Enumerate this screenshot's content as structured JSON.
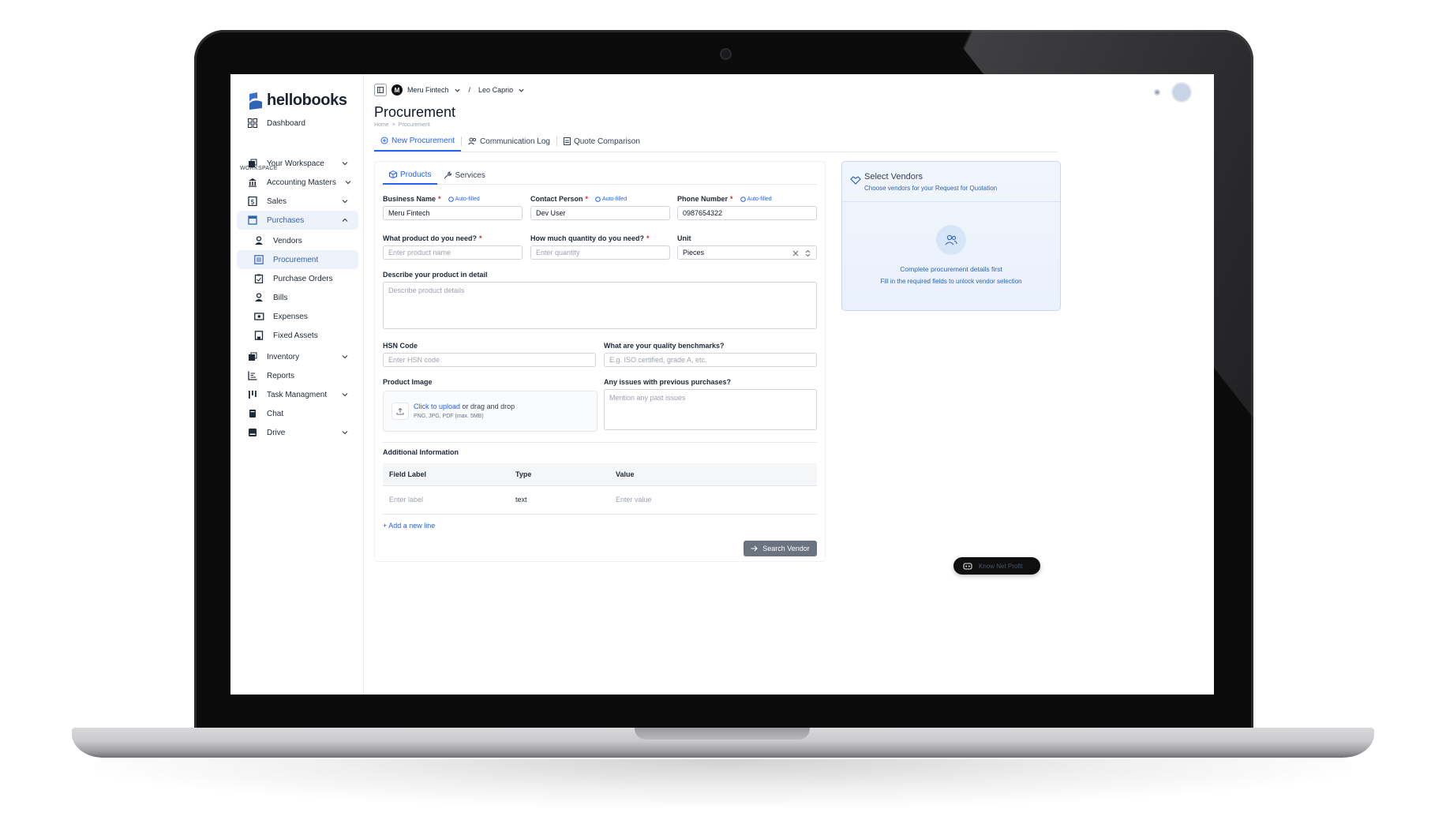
{
  "app": {
    "logo_text": "hellobooks",
    "brand_color": "#2e63b8",
    "accent_color": "#2563eb"
  },
  "topbar": {
    "org_badge": "M",
    "org_name": "Meru Fintech",
    "separator": "/",
    "user_name": "Leo Caprio"
  },
  "sidebar": {
    "dashboard": "Dashboard",
    "workspace_heading": "WORKSPACE",
    "items": [
      {
        "label": "Your Workspace",
        "icon": "workspace-icon"
      },
      {
        "label": "Accounting Masters",
        "icon": "bank-icon"
      },
      {
        "label": "Sales",
        "icon": "dollar-icon"
      },
      {
        "label": "Purchases",
        "icon": "cart-icon"
      },
      {
        "label": "Vendors",
        "icon": "person-icon"
      },
      {
        "label": "Procurement",
        "icon": "list-icon"
      },
      {
        "label": "Purchase Orders",
        "icon": "clipboard-icon"
      },
      {
        "label": "Bills",
        "icon": "person-icon"
      },
      {
        "label": "Expenses",
        "icon": "cash-icon"
      },
      {
        "label": "Fixed Assets",
        "icon": "asset-icon"
      },
      {
        "label": "Inventory",
        "icon": "box-icon"
      },
      {
        "label": "Reports",
        "icon": "chart-icon"
      },
      {
        "label": "Task Managment",
        "icon": "task-icon"
      },
      {
        "label": "Chat",
        "icon": "chat-icon"
      },
      {
        "label": "Drive",
        "icon": "drive-icon"
      }
    ]
  },
  "page": {
    "title": "Procurement",
    "breadcrumb": [
      "Home",
      ">",
      "Procurement"
    ],
    "tabs": [
      "New Procurement",
      "Communication Log",
      "Quote Comparison"
    ]
  },
  "form": {
    "subtabs": [
      "Products",
      "Services"
    ],
    "autofilled": "Auto-filled",
    "business_name": {
      "label": "Business Name",
      "value": "Meru Fintech"
    },
    "contact_person": {
      "label": "Contact Person",
      "value": "Dev User"
    },
    "phone_number": {
      "label": "Phone Number",
      "value": "0987654322"
    },
    "product": {
      "label": "What product do you need?",
      "placeholder": "Enter product name"
    },
    "quantity": {
      "label": "How much quantity do you need?",
      "placeholder": "Enter quantity"
    },
    "unit": {
      "label": "Unit",
      "value": "Pieces"
    },
    "describe": {
      "label": "Describe your product in detail",
      "placeholder": "Describe product details"
    },
    "hsn": {
      "label": "HSN Code",
      "placeholder": "Enter HSN code"
    },
    "benchmarks": {
      "label": "What are your quality benchmarks?",
      "placeholder": "E.g. ISO certified, grade A, etc."
    },
    "image": {
      "label": "Product Image",
      "link": "Click to upload",
      "rest": " or drag and drop",
      "hint": "PNG, JPG, PDF (max. 5MB)"
    },
    "issues": {
      "label": "Any issues with previous purchases?",
      "placeholder": "Mention any past issues"
    },
    "additional": {
      "title": "Additional Information",
      "headers": [
        "Field Label",
        "Type",
        "Value"
      ],
      "row": {
        "label_placeholder": "Enter label",
        "type": "text",
        "value_placeholder": "Enter value"
      },
      "add_line": "+ Add a new line"
    },
    "search_button": "Search Vendor"
  },
  "vendors": {
    "title": "Select Vendors",
    "subtitle": "Choose vendors for your Request for Quotation",
    "message": "Complete procurement details first",
    "hint": "Fill in the required fields to unlock vendor selection"
  },
  "chat_pill": "Know Net Profit"
}
